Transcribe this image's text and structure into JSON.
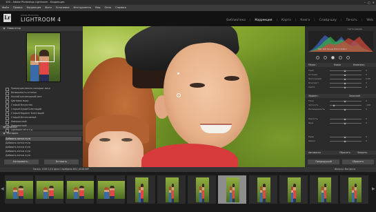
{
  "window": {
    "title": "100 - Adobe Photoshop Lightroom - Коррекция",
    "controls": [
      "–",
      "□",
      "×"
    ]
  },
  "menu": [
    "Файл",
    "Правка",
    "Коррекция",
    "Фото",
    "Установки",
    "Инструменты",
    "Вид",
    "Окно",
    "Справка"
  ],
  "identity": {
    "logo": "Lr",
    "brand_small": "Adobe Photoshop",
    "brand": "LIGHTROOM 4"
  },
  "modules": {
    "items": [
      "Библиотека",
      "Коррекция",
      "Карта",
      "Книга",
      "Слайд-шоу",
      "Печать",
      "Web"
    ],
    "active_index": 1
  },
  "left_panel": {
    "navigator_label": "Навигатор",
    "presets": [
      "Преимущественно молодые лица",
      "Возможность оттенок",
      "Ночной или вечерний свет",
      "Цветовая мадо",
      "Старый Искусство",
      "Старый Бурый Блестящий",
      "Старый Вариант Блестящий",
      "Старый Интенсивный",
      "Невероятный",
      "Невероятный",
      "Lightroom ref и т.д."
    ],
    "snapshots_label": "Снимки",
    "history_label": "История",
    "history": [
      "Добавить метки пути",
      "Добавить метки пути",
      "Добавить метки пути",
      "Добавить метки пути",
      "Добавить метки пути"
    ],
    "history_selected_index": 0,
    "buttons": [
      "Копировать...",
      "Вставить"
    ]
  },
  "right_panel": {
    "histogram_label": "Гистограмма",
    "histogram_readout": "ISO 100   50 мм   f/4.0   1/160 с",
    "sections": {
      "mask_label": "Маска :",
      "mask_options": [
        "Новая",
        "Изменить"
      ],
      "effect_label": "Эффект :",
      "custom": "Заказной",
      "sliders": [
        {
          "name": "Темп",
          "value": "0"
        },
        {
          "name": "Оттенок",
          "value": "0"
        },
        {
          "name": "Экспозиция",
          "value": "0.00"
        },
        {
          "name": "Контраст",
          "value": "0"
        },
        {
          "name": "Света",
          "value": "0"
        },
        {
          "name": "Тени",
          "value": "0"
        },
        {
          "name": "Четкость",
          "value": "-100"
        },
        {
          "name": "Насыщенность",
          "value": "0"
        },
        {
          "name": "Резкость",
          "value": "0"
        },
        {
          "name": "Шум",
          "value": "0"
        },
        {
          "name": "Муар",
          "value": "0"
        },
        {
          "name": "Ореол",
          "value": "0"
        }
      ],
      "slider_levels": [
        0.5,
        0.5,
        0.5,
        0.5,
        0.5,
        0.5,
        0.15,
        0.5,
        0.5,
        0.5,
        0.5,
        0.5
      ],
      "auto_mask": "Автомаска",
      "close": "Закрыть",
      "reset": "Сбросить"
    },
    "buttons": [
      "Предыдущий",
      "Сбросить"
    ]
  },
  "toolbar": {
    "left": "Папки: 1395  1/10 фото  1 выбрано  DSC_0038.NEF",
    "right": "Фильтр:   Все фото"
  },
  "filmstrip": {
    "count": 12,
    "selected_index": 7
  },
  "colors": {
    "accent": "#d8d8d8",
    "panel": "#2b2b2b",
    "background": "#1e1e1e",
    "shirt": "#d83a3c"
  }
}
